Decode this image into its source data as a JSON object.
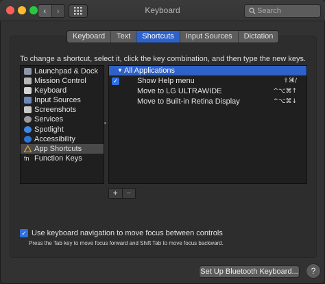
{
  "window": {
    "title": "Keyboard"
  },
  "toolbar": {
    "back_glyph": "‹",
    "forward_glyph": "›",
    "search_placeholder": "Search"
  },
  "tabs": [
    {
      "label": "Keyboard",
      "active": false
    },
    {
      "label": "Text",
      "active": false
    },
    {
      "label": "Shortcuts",
      "active": true
    },
    {
      "label": "Input Sources",
      "active": false
    },
    {
      "label": "Dictation",
      "active": false
    }
  ],
  "instruction": "To change a shortcut, select it, click the key combination, and then type the new keys.",
  "categories": [
    {
      "label": "Launchpad & Dock",
      "icon": "launchpad-icon",
      "selected": false
    },
    {
      "label": "Mission Control",
      "icon": "mission-control-icon",
      "selected": false
    },
    {
      "label": "Keyboard",
      "icon": "keyboard-icon",
      "selected": false
    },
    {
      "label": "Input Sources",
      "icon": "input-sources-icon",
      "selected": false
    },
    {
      "label": "Screenshots",
      "icon": "screenshots-icon",
      "selected": false
    },
    {
      "label": "Services",
      "icon": "gear-icon",
      "selected": false
    },
    {
      "label": "Spotlight",
      "icon": "spotlight-icon",
      "selected": false
    },
    {
      "label": "Accessibility",
      "icon": "accessibility-icon",
      "selected": false
    },
    {
      "label": "App Shortcuts",
      "icon": "app-shortcuts-icon",
      "selected": true
    },
    {
      "label": "Function Keys",
      "icon": "fn-icon",
      "selected": false
    }
  ],
  "shortcuts": {
    "group_label": "All Applications",
    "rows": [
      {
        "name": "Show Help menu",
        "keys": "⇧⌘/",
        "checked": true
      },
      {
        "name": "Move to LG ULTRAWIDE",
        "keys": "^⌥⌘↑",
        "checked": false
      },
      {
        "name": "Move to Built-in Retina Display",
        "keys": "^⌥⌘↓",
        "checked": false
      }
    ]
  },
  "buttons": {
    "add": "+",
    "remove": "−",
    "bluetooth": "Set Up Bluetooth Keyboard...",
    "help": "?"
  },
  "keyboard_nav": {
    "checked": true,
    "label": "Use keyboard navigation to move focus between controls",
    "hint": "Press the Tab key to move focus forward and Shift Tab to move focus backward."
  },
  "colors": {
    "accent": "#2f62c8",
    "close": "#fe5f57",
    "minimize": "#febc2e",
    "maximize": "#28c840"
  }
}
